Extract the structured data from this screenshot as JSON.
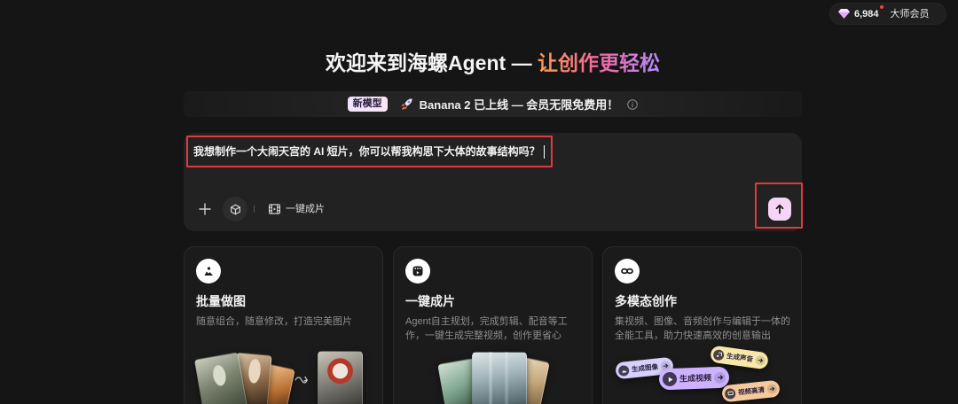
{
  "header": {
    "credits": "6,984",
    "membership": "大师会员"
  },
  "hero": {
    "title": "欢迎来到海螺Agent — ",
    "title_highlight": "让创作更轻松"
  },
  "banner": {
    "badge": "新模型",
    "text": "Banana 2 已上线 — 会员无限免费用！"
  },
  "composer": {
    "value": "我想制作一个大闹天宫的 AI 短片，你可以帮我构思下大体的故事结构吗？",
    "mode_label": "一键成片"
  },
  "cards": [
    {
      "title": "批量做图",
      "description": "随意组合，随意修改，打造完美图片",
      "icon": "image-icon"
    },
    {
      "title": "一键成片",
      "description": "Agent自主规划，完成剪辑、配音等工作，一键生成完整视频，创作更省心",
      "icon": "video-clip-icon"
    },
    {
      "title": "多模态创作",
      "description": "集视频、图像、音频创作与编辑于一体的全能工具，助力快速高效的创意输出",
      "icon": "infinity-icon"
    }
  ],
  "multimodal_actions": [
    {
      "label": "生成图像",
      "color": "#d7cffc"
    },
    {
      "label": "生成声音",
      "color": "#f7e7a8"
    },
    {
      "label": "生成视频",
      "color": "#cdb2ff"
    },
    {
      "label": "视频高清",
      "color": "#f5c99c"
    }
  ],
  "icons": {
    "credits": "gem-icon",
    "banner": "rocket-icon",
    "banner_info": "info-icon",
    "attach": "plus-icon",
    "model": "cube-icon",
    "mode": "film-icon",
    "send": "arrow-up-icon"
  },
  "colors": {
    "background": "#151515",
    "title_gradient": [
      "#ff9b4d",
      "#f2679f",
      "#b48bff"
    ],
    "send_button": "#f6d4f6",
    "annotation_box": "#e3383d",
    "badge": "#efe4ff"
  }
}
